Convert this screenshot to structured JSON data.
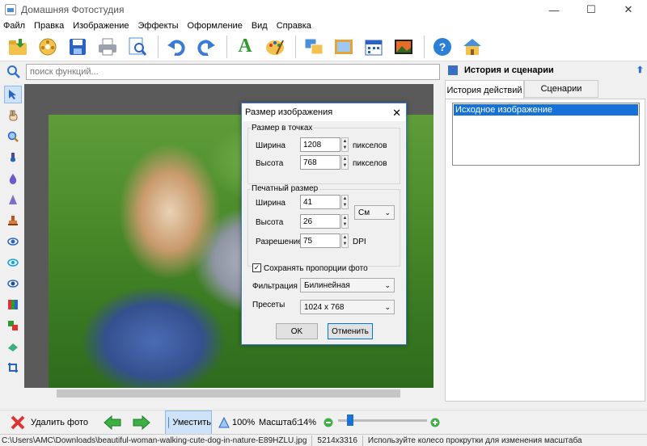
{
  "window": {
    "title": "Домашняя Фотостудия",
    "minimize": "—",
    "maximize": "☐",
    "close": "✕"
  },
  "menu": [
    "Файл",
    "Правка",
    "Изображение",
    "Эффекты",
    "Оформление",
    "Вид",
    "Справка"
  ],
  "search": {
    "placeholder": "поиск функций..."
  },
  "right_panel": {
    "title": "История и сценарии",
    "tabs": [
      "История действий",
      "Сценарии"
    ],
    "history_items": [
      "Исходное изображение"
    ]
  },
  "dialog": {
    "title": "Размер изображения",
    "pixel_group": "Размер в точках",
    "width_label": "Ширина",
    "width_value": "1208",
    "height_label": "Высота",
    "height_value": "768",
    "pixels_unit": "пикселов",
    "print_group": "Печатный размер",
    "print_width_label": "Ширина",
    "print_width_value": "41",
    "print_height_label": "Высота",
    "print_height_value": "26",
    "print_unit": "См",
    "resolution_label": "Разрешение",
    "resolution_value": "75",
    "resolution_unit": "DPI",
    "keep_proportions_label": "Сохранять пропорции фото",
    "keep_proportions_checked": "✓",
    "filter_label": "Фильтрация",
    "filter_value": "Билинейная",
    "presets_label": "Пресеты",
    "presets_value": "1024 x 768",
    "ok_label": "OK",
    "cancel_label": "Отменить"
  },
  "bottom": {
    "delete_label": "Удалить фото",
    "fit_label": "Уместить",
    "zoom100_label": "100%",
    "scale_label": "Масштаб:",
    "scale_value": "14%",
    "zoom_slider_fraction": 0.14
  },
  "status": {
    "path": "C:\\Users\\AMC\\Downloads\\beautiful-woman-walking-cute-dog-in-nature-E89HZLU.jpg",
    "dimensions": "5214x3316",
    "hint": "Используйте колесо прокрутки для изменения масштаба"
  },
  "colors": {
    "accent": "#1672d6",
    "selection_bg": "#cfe3f8"
  }
}
